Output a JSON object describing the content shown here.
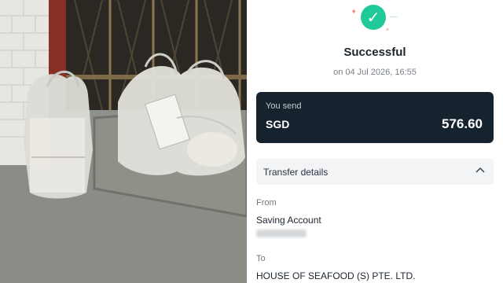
{
  "receipt": {
    "status_title": "Successful",
    "status_time": "on 04 Jul 2026, 16:55",
    "amount_label": "You send",
    "currency": "SGD",
    "amount": "576.60",
    "details_label": "Transfer details",
    "from_label": "From",
    "from_account": "Saving Account",
    "to_label": "To",
    "to_name": "HOUSE OF SEAFOOD (S) PTE. LTD."
  },
  "icons": {
    "success": "check-circle-icon",
    "details_toggle": "chevron-up-icon"
  },
  "colors": {
    "success_green": "#20c997",
    "card_dark": "#16232f",
    "details_bg": "#f2f4f6"
  }
}
